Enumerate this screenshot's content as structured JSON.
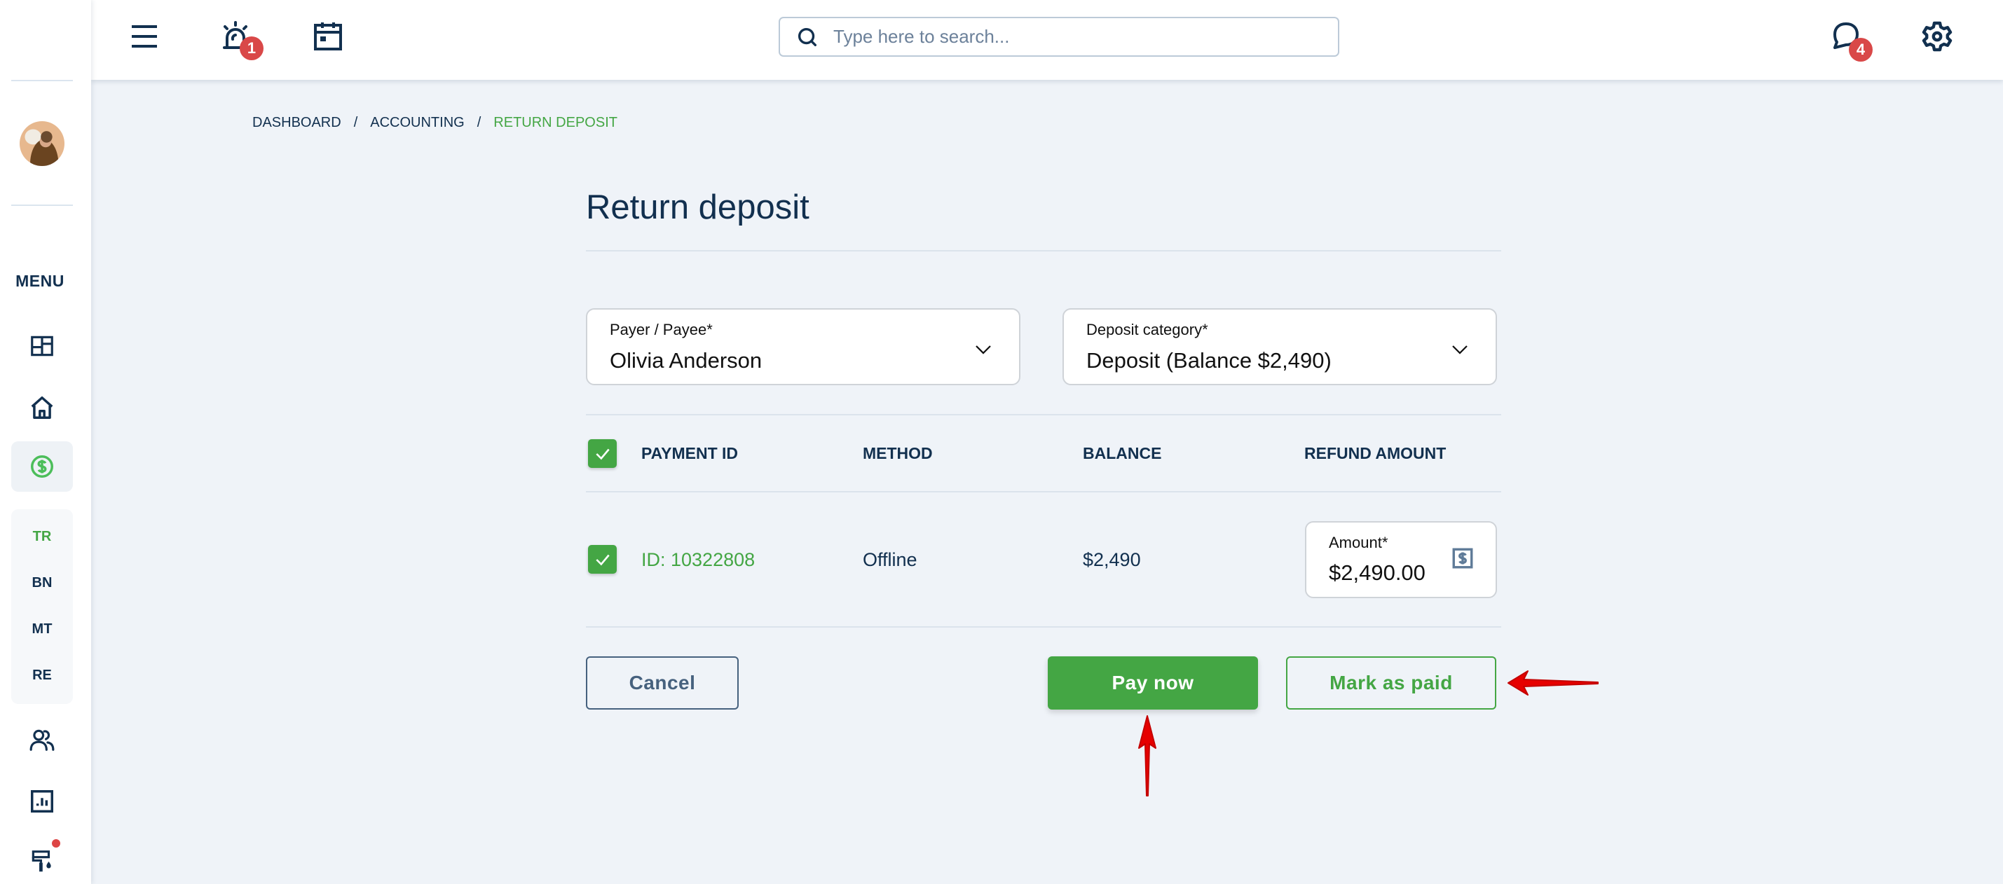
{
  "sidebar": {
    "avatar_alt": "User avatar",
    "menu_label": "MENU",
    "sub_items": [
      {
        "label": "TR",
        "active": true
      },
      {
        "label": "BN",
        "active": false
      },
      {
        "label": "MT",
        "active": false
      },
      {
        "label": "RE",
        "active": false
      }
    ]
  },
  "header": {
    "alerts_badge": "1",
    "messages_badge": "4",
    "search": {
      "placeholder": "Type here to search...",
      "value": ""
    }
  },
  "breadcrumb": [
    {
      "label": "DASHBOARD"
    },
    {
      "label": "ACCOUNTING"
    },
    {
      "label": "RETURN DEPOSIT"
    }
  ],
  "breadcrumb_separator": "/",
  "page": {
    "title": "Return deposit",
    "payer_field": {
      "label": "Payer / Payee*",
      "value": "Olivia Anderson"
    },
    "category_field": {
      "label": "Deposit category*",
      "value": "Deposit (Balance $2,490)"
    },
    "table": {
      "headers": [
        "PAYMENT ID",
        "METHOD",
        "BALANCE",
        "REFUND AMOUNT"
      ],
      "select_all_checked": true,
      "rows": [
        {
          "checked": true,
          "payment_id": "ID: 10322808",
          "method": "Offline",
          "balance": "$2,490",
          "amount_label": "Amount*",
          "amount_value": "$2,490.00"
        }
      ]
    },
    "buttons": {
      "cancel": "Cancel",
      "pay_now": "Pay now",
      "mark_as_paid": "Mark as paid"
    }
  },
  "colors": {
    "accent": "#44a644",
    "text_primary": "#12304f",
    "badge": "#d94848",
    "background": "#eff3f8",
    "annotation_arrow": "#e60000"
  }
}
